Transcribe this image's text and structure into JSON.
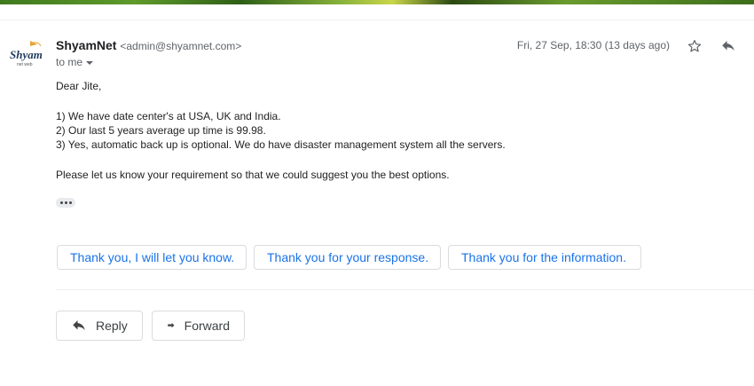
{
  "sender": {
    "name": "ShyamNet",
    "email": "<admin@shyamnet.com>",
    "to_label": "to me",
    "avatar_text": "Shyam",
    "avatar_subtext": "net web"
  },
  "meta": {
    "date": "Fri, 27 Sep, 18:30 (13 days ago)"
  },
  "body": {
    "greeting": "Dear  Jite,",
    "lines": [
      "1) We have date center's at USA, UK and India.",
      "2) Our last 5 years average up time is 99.98.",
      "3) Yes, automatic back up is optional. We do have disaster management system all the servers."
    ],
    "closing": "Please let us know your requirement so that we could suggest you the best options."
  },
  "smart_replies": [
    "Thank you, I will let you know.",
    "Thank you for your response.",
    "Thank you for the information."
  ],
  "actions": {
    "reply_label": "Reply",
    "forward_label": "Forward"
  },
  "icons": {
    "star": "star-outline-icon",
    "reply": "reply-arrow-icon",
    "forward": "forward-arrow-icon",
    "dropdown": "caret-down-icon",
    "more": "ellipsis-icon"
  },
  "colors": {
    "link_blue": "#1a73e8",
    "text_primary": "#202124",
    "text_secondary": "#5f6368",
    "border": "#dadce0"
  }
}
